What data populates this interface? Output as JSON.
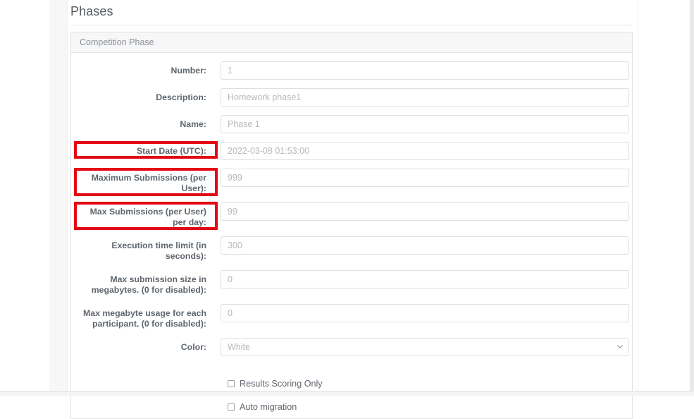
{
  "page": {
    "section_title": "Phases",
    "panel_title": "Competition Phase"
  },
  "form": {
    "fields": [
      {
        "label": "Number:",
        "value": "1",
        "type": "text",
        "highlight": false
      },
      {
        "label": "Description:",
        "value": "Homework phase1",
        "type": "text",
        "highlight": false
      },
      {
        "label": "Name:",
        "value": "Phase 1",
        "type": "text",
        "highlight": false
      },
      {
        "label": "Start Date (UTC):",
        "value": "2022-03-08 01:53:00",
        "type": "text",
        "highlight": true
      },
      {
        "label": "Maximum Submissions (per User):",
        "value": "999",
        "type": "text",
        "highlight": true
      },
      {
        "label": "Max Submissions (per User) per day:",
        "value": "99",
        "type": "text",
        "highlight": true
      },
      {
        "label": "Execution time limit (in seconds):",
        "value": "300",
        "type": "text",
        "highlight": false
      },
      {
        "label": "Max submission size in megabytes. (0 for disabled):",
        "value": "0",
        "type": "text",
        "highlight": false
      },
      {
        "label": "Max megabyte usage for each participant. (0 for disabled):",
        "value": "0",
        "type": "text",
        "highlight": false
      },
      {
        "label": "Color:",
        "value": "White",
        "type": "select",
        "highlight": false
      }
    ],
    "checkboxes": [
      {
        "label": "Results Scoring Only",
        "checked": false
      },
      {
        "label": "Auto migration",
        "checked": false
      }
    ]
  },
  "icons": {
    "chevron_down": "chevron-down-icon"
  },
  "colors": {
    "highlight": "#e30613",
    "label_text": "#5f666d",
    "input_text": "#b6b9bd",
    "panel_border": "#e3e3e3",
    "panel_header_bg": "#f7f7f7"
  }
}
